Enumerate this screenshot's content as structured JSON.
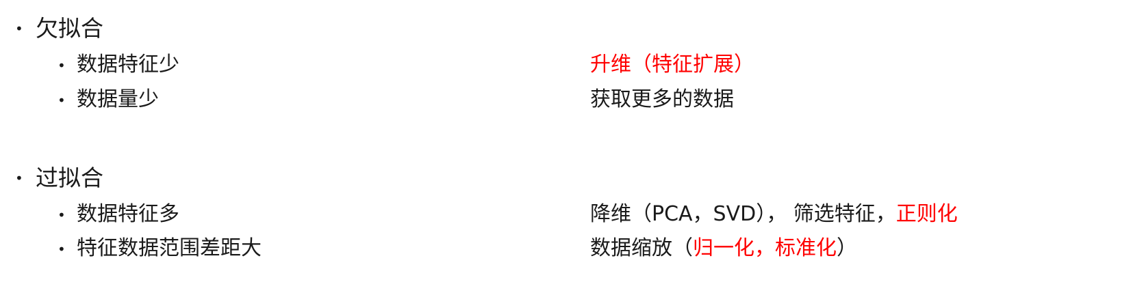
{
  "sections": [
    {
      "heading": "欠拟合",
      "items": [
        {
          "label": "数据特征少",
          "remedy": [
            {
              "text": "升维（特征扩展）",
              "color": "#ff0000"
            }
          ]
        },
        {
          "label": "数据量少",
          "remedy": [
            {
              "text": "获取更多的数据",
              "color": "#1a1a1a"
            }
          ]
        }
      ]
    },
    {
      "heading": "过拟合",
      "items": [
        {
          "label": "数据特征多",
          "remedy": [
            {
              "text": "降维（PCA，SVD）， 筛选特征，",
              "color": "#1a1a1a"
            },
            {
              "text": "正则化",
              "color": "#ff0000"
            }
          ]
        },
        {
          "label": "特征数据范围差距大",
          "remedy": [
            {
              "text": "数据缩放（",
              "color": "#1a1a1a"
            },
            {
              "text": "归一化，标准化",
              "color": "#ff0000"
            },
            {
              "text": "）",
              "color": "#1a1a1a"
            }
          ]
        }
      ]
    }
  ],
  "bullet_char": "•"
}
